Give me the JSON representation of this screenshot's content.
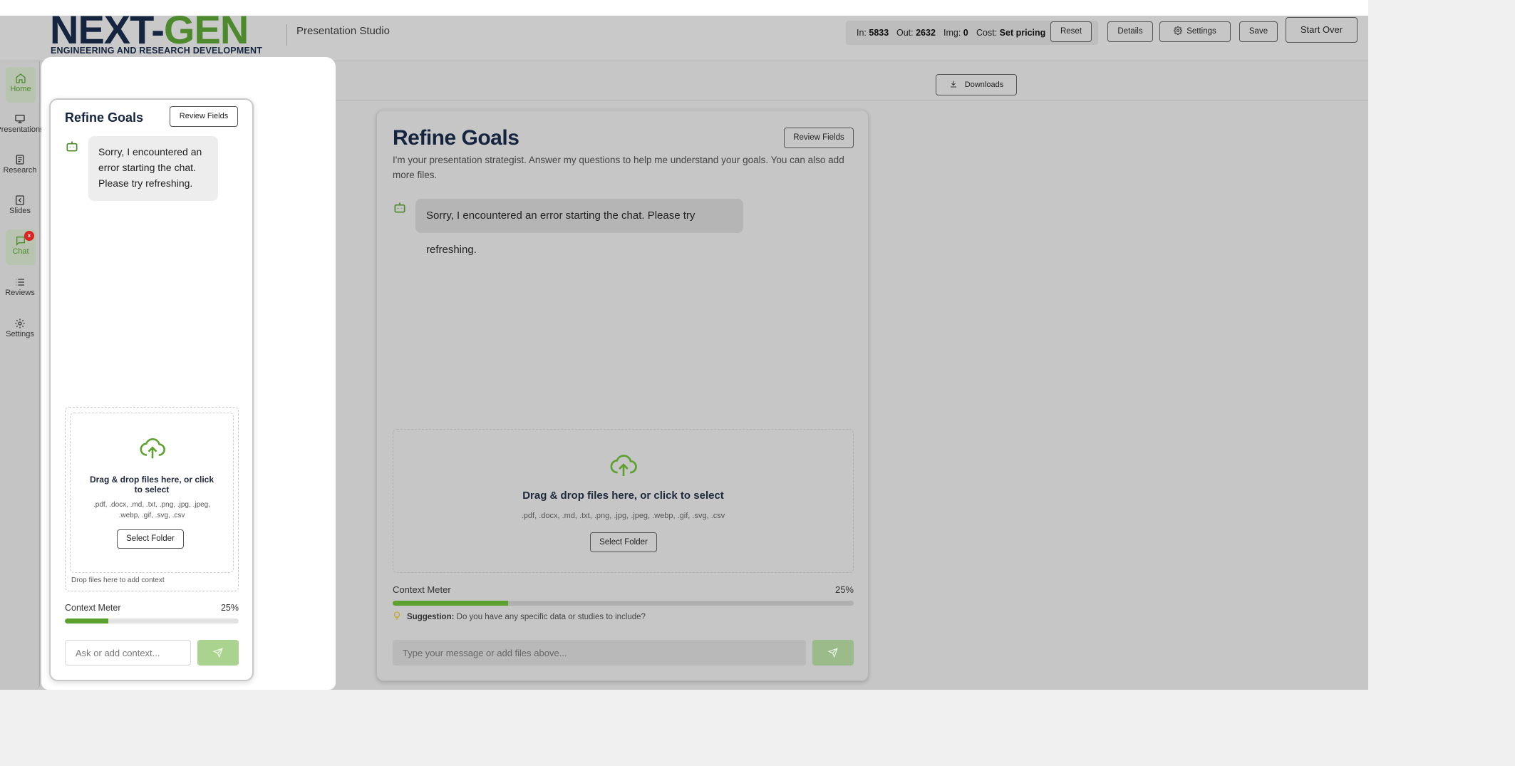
{
  "brand": {
    "logo_next": "NEXT-",
    "logo_gen": "GEN",
    "logo_sub": "ENGINEERING AND RESEARCH DEVELOPMENT",
    "app_name": "Presentation Studio"
  },
  "usage": {
    "in_label": "In:",
    "in_value": "5833",
    "out_label": "Out:",
    "out_value": "2632",
    "img_label": "Img:",
    "img_value": "0",
    "cost_label": "Cost:",
    "cost_value": "Set pricing"
  },
  "header_buttons": {
    "reset": "Reset",
    "details": "Details",
    "settings": "Settings",
    "save": "Save",
    "start_over": "Start Over"
  },
  "sidebar": {
    "items": [
      {
        "label": "Home",
        "icon": "home-icon",
        "active": true
      },
      {
        "label": "Presentations",
        "icon": "presentation-icon"
      },
      {
        "label": "Research",
        "icon": "research-icon"
      },
      {
        "label": "Slides",
        "icon": "slides-icon"
      },
      {
        "label": "Chat",
        "icon": "chat-icon",
        "badge": "x"
      },
      {
        "label": "Reviews",
        "icon": "list-icon"
      },
      {
        "label": "Settings",
        "icon": "gear-icon"
      }
    ]
  },
  "toolbar": {
    "downloads": "Downloads"
  },
  "main": {
    "title": "Refine Goals",
    "review_button": "Review Fields",
    "intro": "I'm your presentation strategist. Answer my questions to help me understand your goals. You can also add more files.",
    "bot_message": "Sorry, I encountered an error starting the chat. Please try refreshing.",
    "dropzone_title": "Drag & drop files here, or click to select",
    "dropzone_types": ".pdf, .docx, .md, .txt, .png, .jpg, .jpeg, .webp, .gif, .svg, .csv",
    "select_folder": "Select Folder",
    "meter_label": "Context Meter",
    "meter_value": "25%",
    "meter_fraction": 0.25,
    "suggestion_label": "Suggestion:",
    "suggestion_text": "Do you have any specific data or studies to include?",
    "input_placeholder": "Type your message or add files above..."
  },
  "panel": {
    "title": "Refine Goals",
    "review_button": "Review Fields",
    "bot_message": "Sorry, I encountered an error starting the chat. Please try refreshing.",
    "dropzone_title": "Drag & drop files here, or click to select",
    "dropzone_types": ".pdf, .docx, .md, .txt, .png, .jpg, .jpeg, .webp, .gif, .svg, .csv",
    "select_folder": "Select Folder",
    "drop_hint": "Drop files here to add context",
    "meter_label": "Context Meter",
    "meter_value": "25%",
    "meter_fraction": 0.25,
    "input_placeholder": "Ask or add context..."
  },
  "colors": {
    "brand_navy": "#15253f",
    "brand_green": "#4d8a2d",
    "meter_fill": "#5ca02e",
    "send_button": "#9cbb8a",
    "badge": "#dd2222"
  }
}
